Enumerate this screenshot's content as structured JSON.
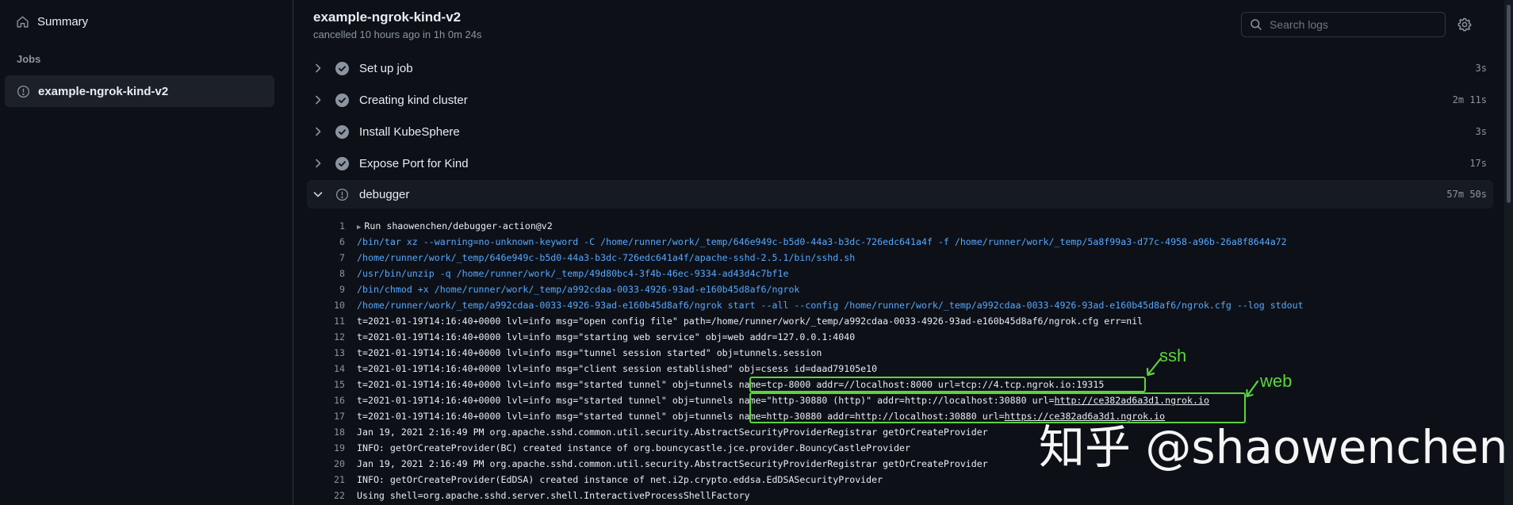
{
  "sidebar": {
    "summary_label": "Summary",
    "jobs_heading": "Jobs",
    "job_name": "example-ngrok-kind-v2"
  },
  "header": {
    "title": "example-ngrok-kind-v2",
    "subtitle": "cancelled 10 hours ago in 1h 0m 24s",
    "search_placeholder": "Search logs"
  },
  "steps": [
    {
      "label": "Set up job",
      "duration": "3s",
      "status": "success"
    },
    {
      "label": "Creating kind cluster",
      "duration": "2m 11s",
      "status": "success"
    },
    {
      "label": "Install KubeSphere",
      "duration": "3s",
      "status": "success"
    },
    {
      "label": "Expose Port for Kind",
      "duration": "17s",
      "status": "success"
    },
    {
      "label": "debugger",
      "duration": "57m 50s",
      "status": "cancelled"
    }
  ],
  "log_lines": [
    {
      "n": "1",
      "t": "Run shaowenchen/debugger-action@v2"
    },
    {
      "n": "6",
      "t": "/bin/tar xz --warning=no-unknown-keyword -C /home/runner/work/_temp/646e949c-b5d0-44a3-b3dc-726edc641a4f -f /home/runner/work/_temp/5a8f99a3-d77c-4958-a96b-26a8f8644a72"
    },
    {
      "n": "7",
      "t": "/home/runner/work/_temp/646e949c-b5d0-44a3-b3dc-726edc641a4f/apache-sshd-2.5.1/bin/sshd.sh"
    },
    {
      "n": "8",
      "t": "/usr/bin/unzip -q /home/runner/work/_temp/49d80bc4-3f4b-46ec-9334-ad43d4c7bf1e"
    },
    {
      "n": "9",
      "t": "/bin/chmod +x /home/runner/work/_temp/a992cdaa-0033-4926-93ad-e160b45d8af6/ngrok"
    },
    {
      "n": "10",
      "t": "/home/runner/work/_temp/a992cdaa-0033-4926-93ad-e160b45d8af6/ngrok start --all --config /home/runner/work/_temp/a992cdaa-0033-4926-93ad-e160b45d8af6/ngrok.cfg --log stdout"
    },
    {
      "n": "11",
      "t": "t=2021-01-19T14:16:40+0000 lvl=info msg=\"open config file\" path=/home/runner/work/_temp/a992cdaa-0033-4926-93ad-e160b45d8af6/ngrok.cfg err=nil"
    },
    {
      "n": "12",
      "t": "t=2021-01-19T14:16:40+0000 lvl=info msg=\"starting web service\" obj=web addr=127.0.0.1:4040"
    },
    {
      "n": "13",
      "t": "t=2021-01-19T14:16:40+0000 lvl=info msg=\"tunnel session started\" obj=tunnels.session"
    },
    {
      "n": "14",
      "t": "t=2021-01-19T14:16:40+0000 lvl=info msg=\"client session established\" obj=csess id=daad79105e10"
    },
    {
      "n": "15",
      "a": "t=2021-01-19T14:16:40+0000 lvl=info msg=\"started tunnel\" obj=tunnels ",
      "b": "name=tcp-8000 addr=//localhost:8000 url=tcp://4.tcp.ngrok.io:19315"
    },
    {
      "n": "16",
      "a": "t=2021-01-19T14:16:40+0000 lvl=info msg=\"started tunnel\" obj=tunnels ",
      "b": "name=\"http-30880 (http)\" addr=http://localhost:30880 url=",
      "c": "http://ce382ad6a3d1.ngrok.io"
    },
    {
      "n": "17",
      "a": "t=2021-01-19T14:16:40+0000 lvl=info msg=\"started tunnel\" obj=tunnels ",
      "b": "name=http-30880 addr=http://localhost:30880 url=",
      "c": "https://ce382ad6a3d1.ngrok.io"
    },
    {
      "n": "18",
      "t": "Jan 19, 2021 2:16:49 PM org.apache.sshd.common.util.security.AbstractSecurityProviderRegistrar getOrCreateProvider"
    },
    {
      "n": "19",
      "t": "INFO: getOrCreateProvider(BC) created instance of org.bouncycastle.jce.provider.BouncyCastleProvider"
    },
    {
      "n": "20",
      "t": "Jan 19, 2021 2:16:49 PM org.apache.sshd.common.util.security.AbstractSecurityProviderRegistrar getOrCreateProvider"
    },
    {
      "n": "21",
      "t": "INFO: getOrCreateProvider(EdDSA) created instance of net.i2p.crypto.eddsa.EdDSASecurityProvider"
    },
    {
      "n": "22",
      "t": "Using shell=org.apache.sshd.server.shell.InteractiveProcessShellFactory"
    }
  ],
  "annotations": {
    "ssh_label": "ssh",
    "web_label": "web",
    "highlight_color": "#5bd43c"
  },
  "watermark": "知乎 @shaowenchen"
}
